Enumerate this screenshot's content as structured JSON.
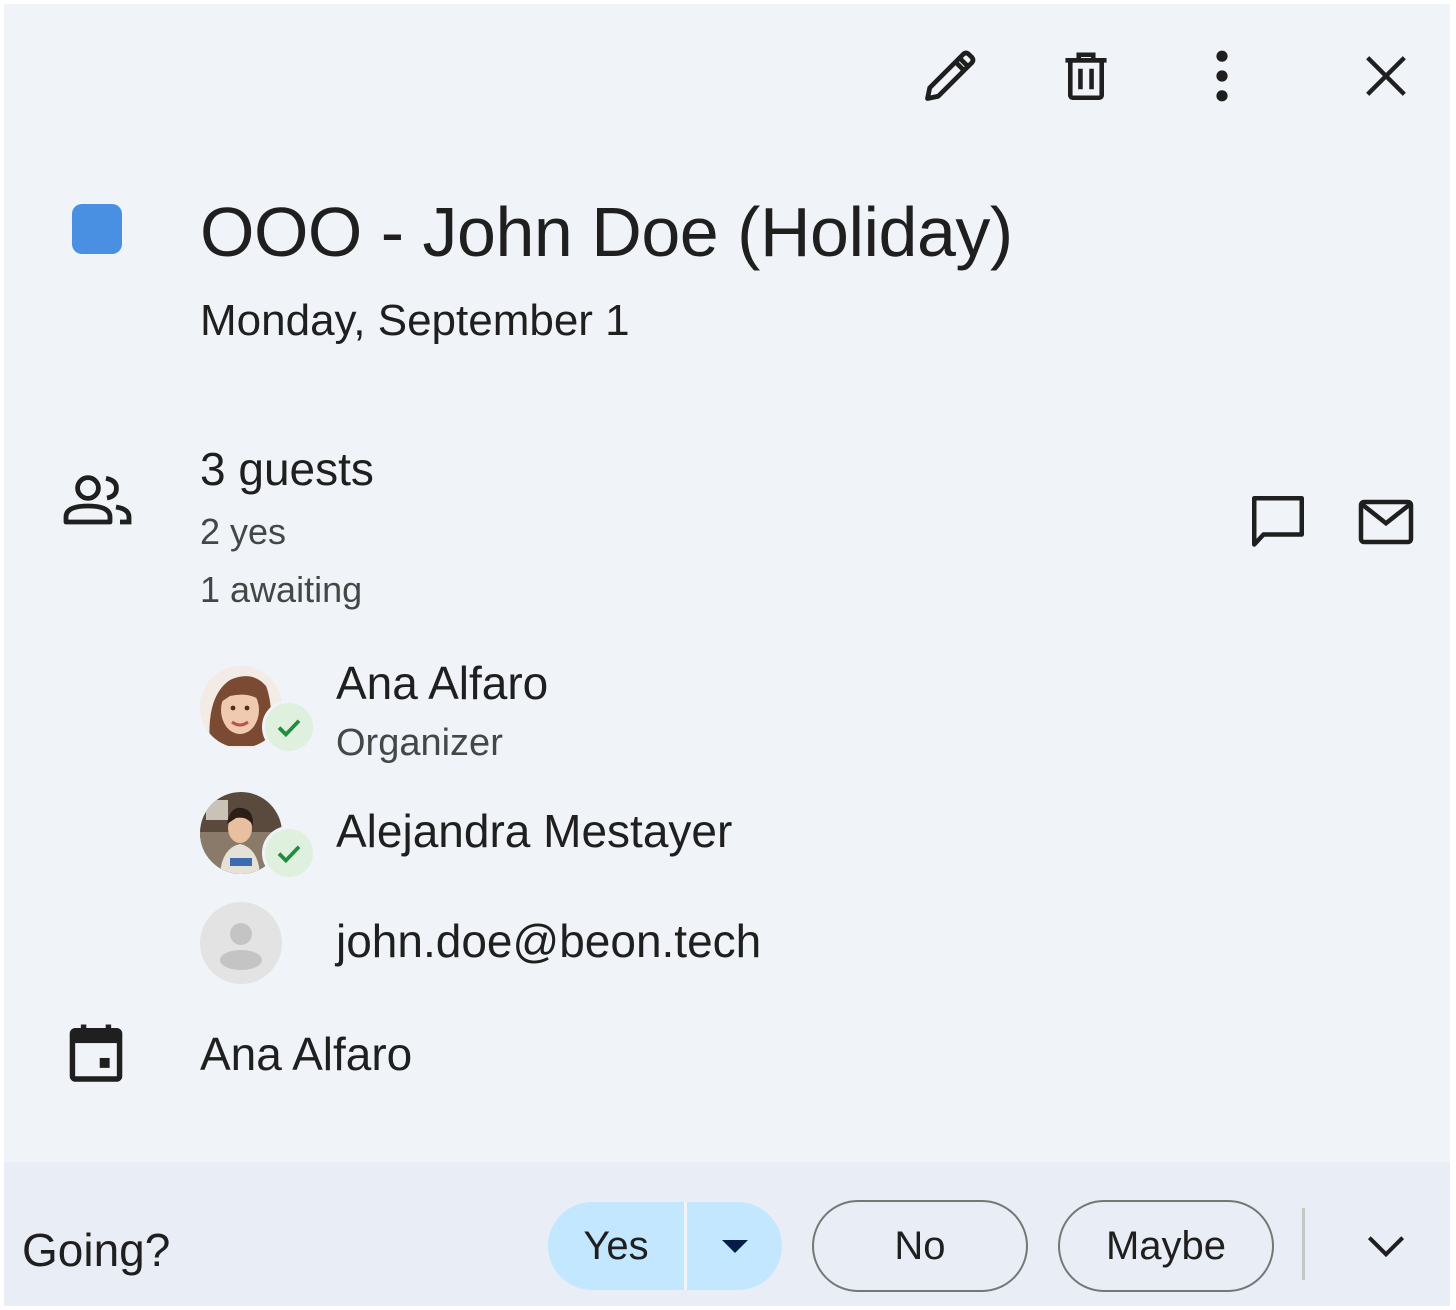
{
  "toolbar": {
    "edit_icon": "pencil-icon",
    "delete_icon": "trash-icon",
    "more_icon": "more-vert-icon",
    "close_icon": "close-icon"
  },
  "event": {
    "color": "#4a90e2",
    "title": "OOO - John Doe (Holiday)",
    "date": "Monday, September 1"
  },
  "guests": {
    "count_label": "3 guests",
    "yes_label": "2 yes",
    "awaiting_label": "1 awaiting",
    "chat_icon": "chat-bubble-icon",
    "email_icon": "email-icon",
    "list": [
      {
        "name": "Ana Alfaro",
        "role": "Organizer",
        "status": "accepted"
      },
      {
        "name": "Alejandra Mestayer",
        "role": "",
        "status": "accepted"
      },
      {
        "name": "john.doe@beon.tech",
        "role": "",
        "status": "awaiting"
      }
    ]
  },
  "calendar": {
    "owner": "Ana Alfaro"
  },
  "rsvp": {
    "prompt": "Going?",
    "yes_label": "Yes",
    "no_label": "No",
    "maybe_label": "Maybe",
    "selected": "Yes",
    "accent_color": "#c2e7ff"
  }
}
